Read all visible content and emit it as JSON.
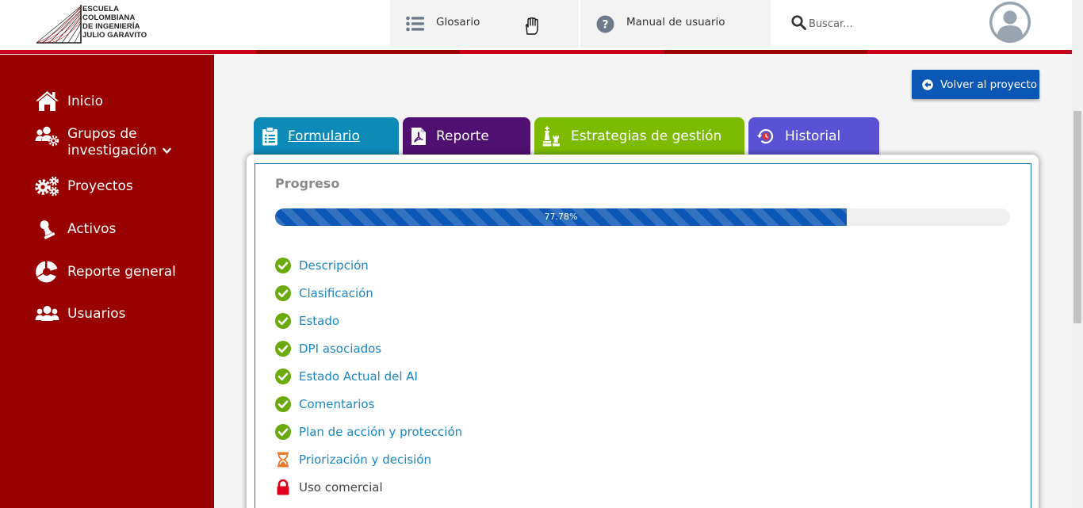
{
  "header": {
    "logo_lines": [
      "Escuela",
      "Colombiana",
      "de Ingeniería",
      "Julio Garavito"
    ],
    "glosario_label": "Glosario",
    "manual_label": "Manual de usuario",
    "search_placeholder": "Buscar..."
  },
  "sidebar": {
    "items": [
      {
        "label": "Inicio",
        "icon": "home-icon"
      },
      {
        "label": "Grupos de",
        "label2": "investigación",
        "icon": "users-cog-icon"
      },
      {
        "label": "Proyectos",
        "icon": "cogs-icon"
      },
      {
        "label": "Activos",
        "icon": "chess-pawn-icon"
      },
      {
        "label": "Reporte general",
        "icon": "pie-chart-icon"
      },
      {
        "label": "Usuarios",
        "icon": "users-icon"
      }
    ]
  },
  "back_button": {
    "label": "Volver al proyecto"
  },
  "tabs": [
    {
      "label": "Formulario",
      "color": "#0d8ab8",
      "active": true
    },
    {
      "label": "Reporte",
      "color": "#4f1072"
    },
    {
      "label": "Estrategias de gestión",
      "color": "#7cbb00"
    },
    {
      "label": "Historial",
      "color": "#5a52d5"
    }
  ],
  "progress": {
    "title": "Progreso",
    "value": 0.7778,
    "label": "77.78%"
  },
  "steps": [
    {
      "label": "Descripción",
      "status": "complete"
    },
    {
      "label": "Clasificación",
      "status": "complete"
    },
    {
      "label": "Estado",
      "status": "complete"
    },
    {
      "label": "DPI asociados",
      "status": "complete"
    },
    {
      "label": "Estado Actual del AI",
      "status": "complete"
    },
    {
      "label": "Comentarios",
      "status": "complete"
    },
    {
      "label": "Plan de acción y protección",
      "status": "complete"
    },
    {
      "label": "Priorización y decisión",
      "status": "pending"
    },
    {
      "label": "Uso comercial",
      "status": "locked"
    }
  ],
  "colors": {
    "sidebar": "#990000",
    "accent_blue": "#0b57b5",
    "complete": "#6aaa0a",
    "pending": "#e8782a",
    "locked": "#e0001b"
  }
}
